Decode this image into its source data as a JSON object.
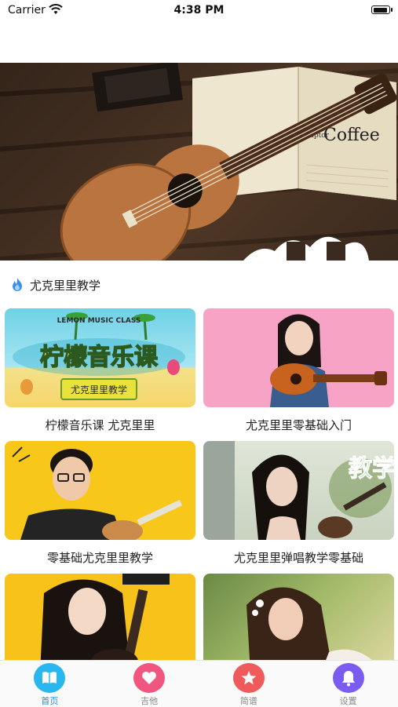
{
  "status_bar": {
    "carrier": "Carrier",
    "time": "4:38 PM"
  },
  "banner": {
    "brand_small": "Sculptor",
    "brand_big": "Coffee"
  },
  "section": {
    "title": "尤克里里教学"
  },
  "cards": [
    {
      "title": "柠檬音乐课 尤克里里",
      "thumb_big": "柠檬音乐课",
      "thumb_small": "LEMON MUSIC CLASS",
      "thumb_tag": "尤克里里教学"
    },
    {
      "title": "尤克里里零基础入门"
    },
    {
      "title": "零基础尤克里里教学"
    },
    {
      "title": "尤克里里弹唱教学零基础",
      "thumb_text": "教学"
    },
    {
      "title": ""
    },
    {
      "title": ""
    }
  ],
  "tabs": [
    {
      "label": "首页",
      "icon": "book-icon",
      "color": "#2ab7f0"
    },
    {
      "label": "吉他",
      "icon": "heart-icon",
      "color": "#f0567f"
    },
    {
      "label": "简谱",
      "icon": "star-icon",
      "color": "#ef5a5a"
    },
    {
      "label": "设置",
      "icon": "bell-icon",
      "color": "#7b5cf0"
    }
  ],
  "colors": {
    "accent": "#1a8fe0"
  }
}
